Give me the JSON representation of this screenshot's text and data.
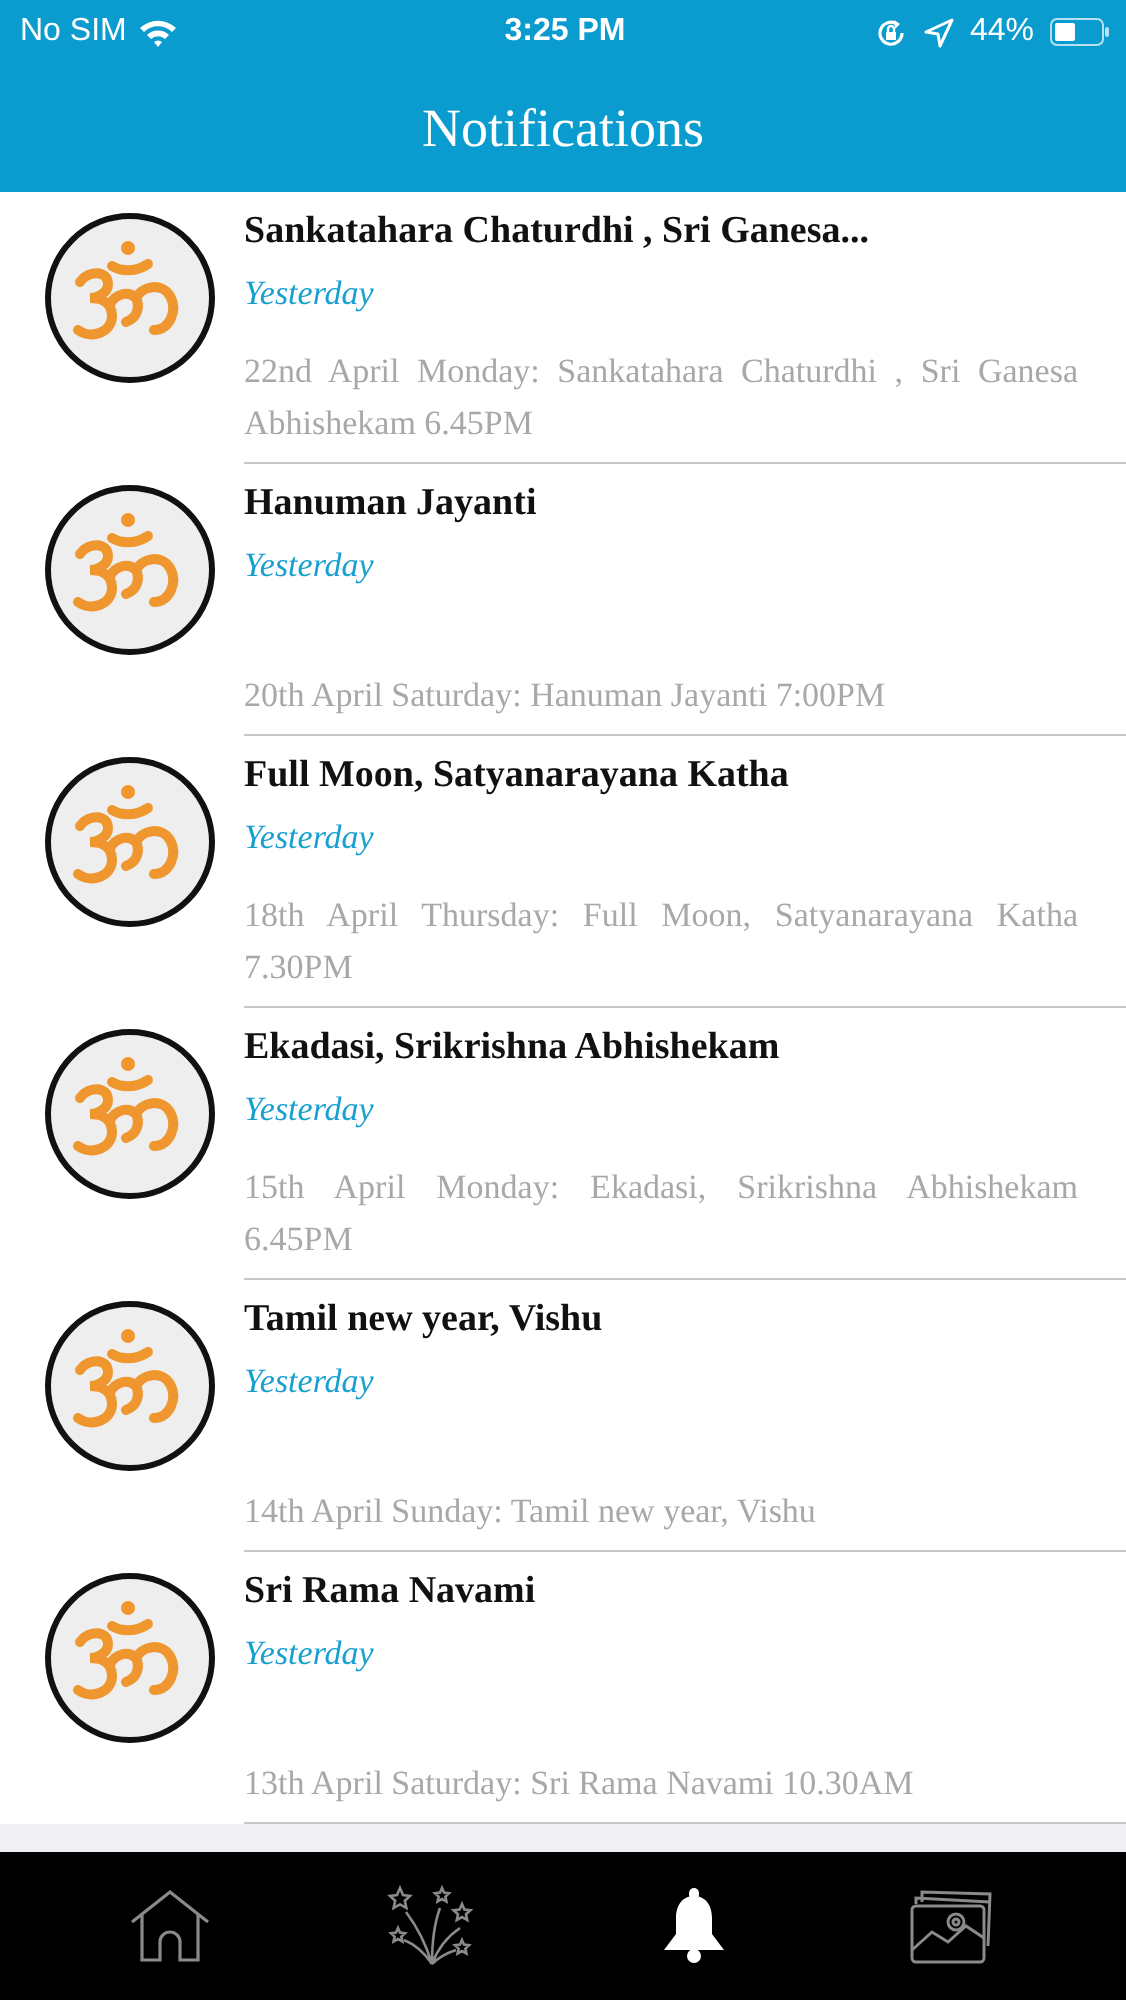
{
  "status_bar": {
    "carrier": "No SIM",
    "time": "3:25 PM",
    "battery": "44%"
  },
  "header": {
    "title": "Notifications"
  },
  "notifications": [
    {
      "title": "Sankatahara Chaturdhi , Sri Ganesa...",
      "time": "Yesterday",
      "message": "22nd April Monday: Sankatahara Chaturdhi , Sri Ganesa Abhishekam 6.45PM"
    },
    {
      "title": "Hanuman Jayanti",
      "time": "Yesterday",
      "message": "20th April Saturday: Hanuman Jayanti 7:00PM"
    },
    {
      "title": "Full Moon, Satyanarayana Katha",
      "time": "Yesterday",
      "message": "18th April Thursday: Full Moon, Satyanarayana Katha 7.30PM"
    },
    {
      "title": "Ekadasi, Srikrishna Abhishekam",
      "time": "Yesterday",
      "message": "15th April Monday: Ekadasi, Srikrishna Abhishekam 6.45PM"
    },
    {
      "title": "Tamil new year, Vishu",
      "time": "Yesterday",
      "message": "14th April Sunday: Tamil new year, Vishu"
    },
    {
      "title": "Sri Rama Navami",
      "time": "Yesterday",
      "message": "13th April Saturday: Sri Rama Navami 10.30AM"
    }
  ],
  "tab_bar": [
    {
      "kind": "home",
      "selected": false
    },
    {
      "kind": "fireworks",
      "selected": false
    },
    {
      "kind": "bell",
      "selected": true
    },
    {
      "kind": "gallery",
      "selected": false
    }
  ]
}
